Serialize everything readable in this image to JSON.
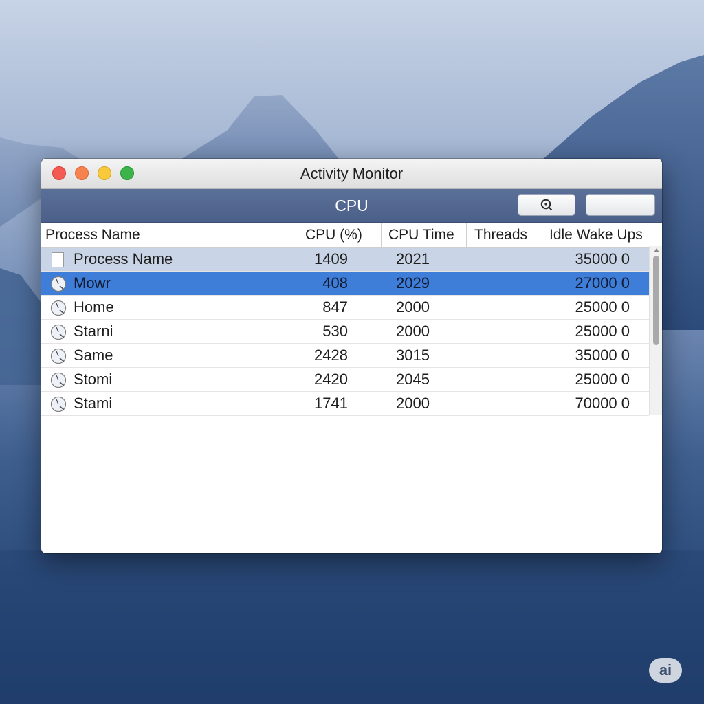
{
  "window": {
    "title": "Activity Monitor"
  },
  "toolbar": {
    "title": "CPU",
    "search_icon": "search-icon",
    "blank_button": ""
  },
  "table": {
    "columns": [
      "Process Name",
      "CPU (%)",
      "CPU Time",
      "Threads",
      "Idle Wake Ups"
    ],
    "rows": [
      {
        "name": "Process Name",
        "cpu": "1409",
        "time": "2021",
        "threads": "",
        "idle": "35000 0",
        "icon": "document-icon",
        "style": "header-like"
      },
      {
        "name": "Mowr",
        "cpu": "408",
        "time": "2029",
        "threads": "",
        "idle": "27000 0",
        "icon": "process-gauge-icon",
        "style": "selected"
      },
      {
        "name": "Home",
        "cpu": "847",
        "time": "2000",
        "threads": "",
        "idle": "25000 0",
        "icon": "process-gauge-icon",
        "style": "normal"
      },
      {
        "name": "Starni",
        "cpu": "530",
        "time": "2000",
        "threads": "",
        "idle": "25000 0",
        "icon": "process-gauge-icon",
        "style": "normal"
      },
      {
        "name": "Same",
        "cpu": "2428",
        "time": "3015",
        "threads": "",
        "idle": "35000 0",
        "icon": "process-gauge-icon",
        "style": "normal"
      },
      {
        "name": "Stomi",
        "cpu": "2420",
        "time": "2045",
        "threads": "",
        "idle": "25000 0",
        "icon": "process-gauge-icon",
        "style": "normal"
      },
      {
        "name": "Stami",
        "cpu": "1741",
        "time": "2000",
        "threads": "",
        "idle": "70000 0",
        "icon": "process-gauge-icon",
        "style": "normal"
      }
    ]
  },
  "badge": {
    "text": "ai"
  },
  "colors": {
    "selected_row": "#3f7ed8",
    "toolbar": "#51668f",
    "close": "#f45a52",
    "minimize": "#f8c93a",
    "zoom": "#3cb44a"
  }
}
